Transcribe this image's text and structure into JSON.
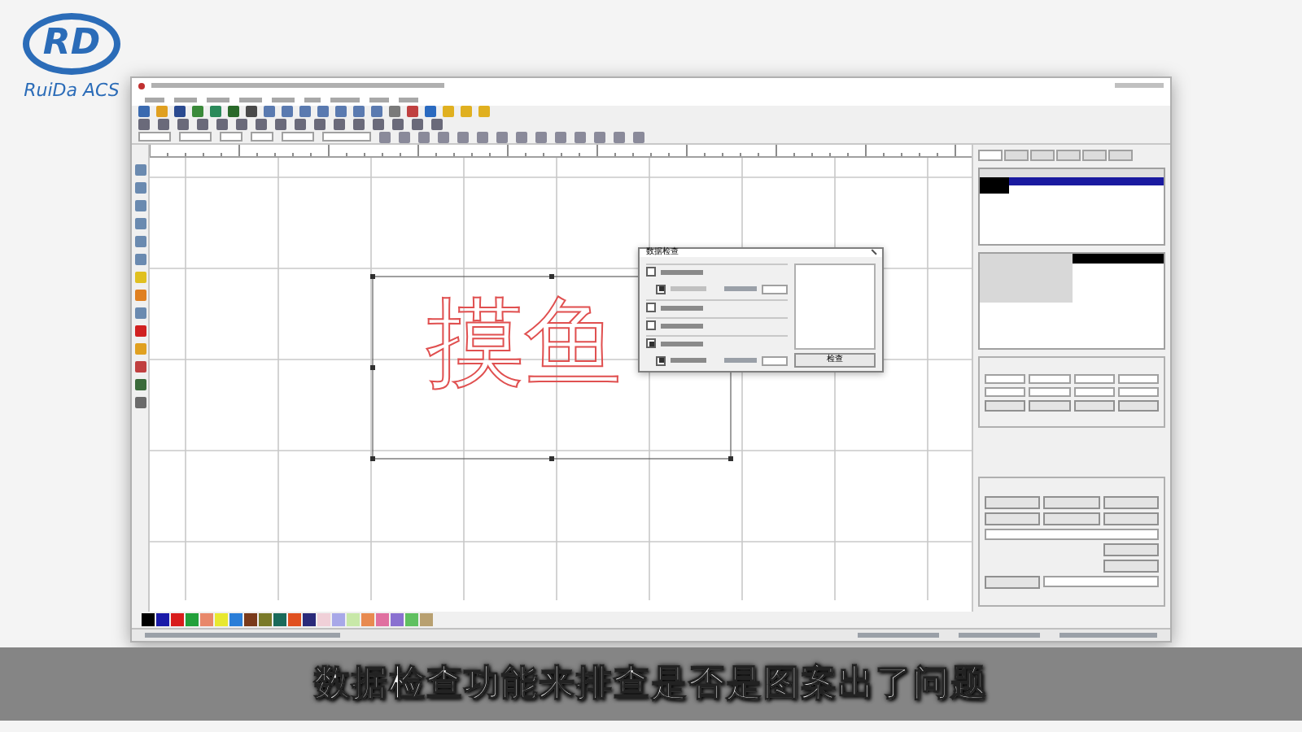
{
  "logo": {
    "mark": "RD",
    "caption": "RuiDa ACS"
  },
  "canvas": {
    "artwork_text": "摸鱼"
  },
  "dialog": {
    "title": "数据检查",
    "button": "检查",
    "options": [
      {
        "kind": "main",
        "checked": false
      },
      {
        "kind": "sub",
        "checked": true
      },
      {
        "kind": "main",
        "checked": false
      },
      {
        "kind": "main",
        "checked": false
      },
      {
        "kind": "main",
        "checked": true
      },
      {
        "kind": "sub",
        "checked": true
      }
    ]
  },
  "panel": {
    "tabs": [
      {
        "selected": true
      },
      {
        "selected": false
      },
      {
        "selected": false
      },
      {
        "selected": false
      },
      {
        "selected": false
      },
      {
        "selected": false
      }
    ]
  },
  "palette": [
    {
      "color": "#000000"
    },
    {
      "color": "#1a1aa8"
    },
    {
      "color": "#d81c1c"
    },
    {
      "color": "#22a03a"
    },
    {
      "color": "#e8886a"
    },
    {
      "color": "#e8e830"
    },
    {
      "color": "#2a7ed8"
    },
    {
      "color": "#7a3a1a"
    },
    {
      "color": "#7a7a2a"
    },
    {
      "color": "#1a6a5a"
    },
    {
      "color": "#e05020"
    },
    {
      "color": "#2a2a7a"
    },
    {
      "color": "#f0d0d8"
    },
    {
      "color": "#a8a8e8"
    },
    {
      "color": "#c8e8a8"
    },
    {
      "color": "#e88a50"
    },
    {
      "color": "#e070a0"
    },
    {
      "color": "#8a70d0"
    },
    {
      "color": "#60c060"
    },
    {
      "color": "#b8a070"
    }
  ],
  "subtitle": "数据检查功能来排查是否是图案出了问题"
}
